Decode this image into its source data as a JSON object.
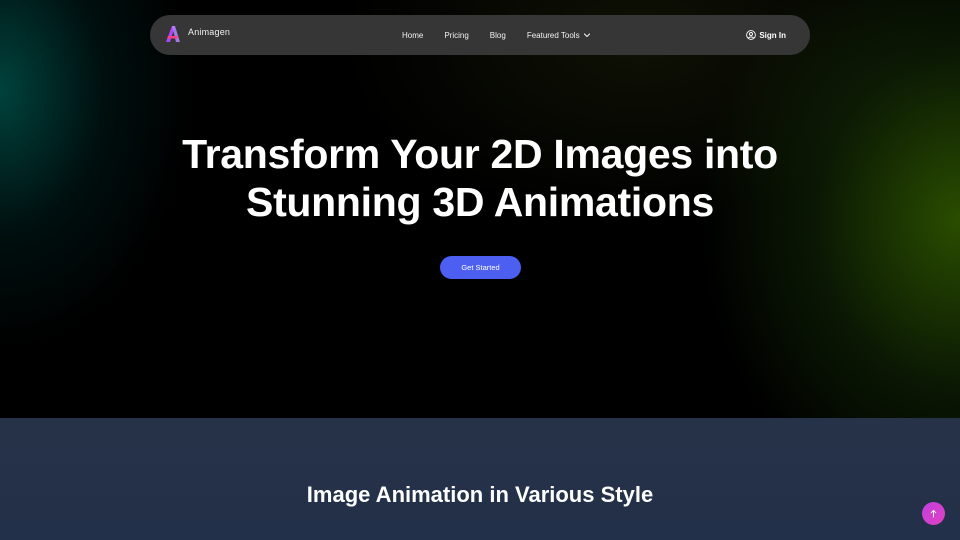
{
  "brand": {
    "name": "Animagen",
    "logo_icon": "animagen-logo-icon",
    "logo_colors": [
      "#e040fb",
      "#7c4dff",
      "#ff4081"
    ]
  },
  "nav": {
    "links": [
      {
        "label": "Home"
      },
      {
        "label": "Pricing"
      },
      {
        "label": "Blog"
      },
      {
        "label": "Featured Tools",
        "icon": "chevron-down-icon"
      }
    ],
    "signin_label": "Sign In",
    "signin_icon": "user-icon"
  },
  "hero": {
    "title_line1": "Transform Your 2D Images into",
    "title_line2": "Stunning 3D Animations",
    "cta_label": "Get Started"
  },
  "section": {
    "title": "Image Animation in Various Style"
  },
  "scroll_top": {
    "icon": "arrow-up-icon"
  },
  "colors": {
    "navbar": "#363636",
    "cta": "#4c5ff0",
    "section_bg": "#263247",
    "scroll_top": "#d03fd6",
    "hero_glow_left": "#006e64",
    "hero_glow_right": "#3c6e00"
  }
}
